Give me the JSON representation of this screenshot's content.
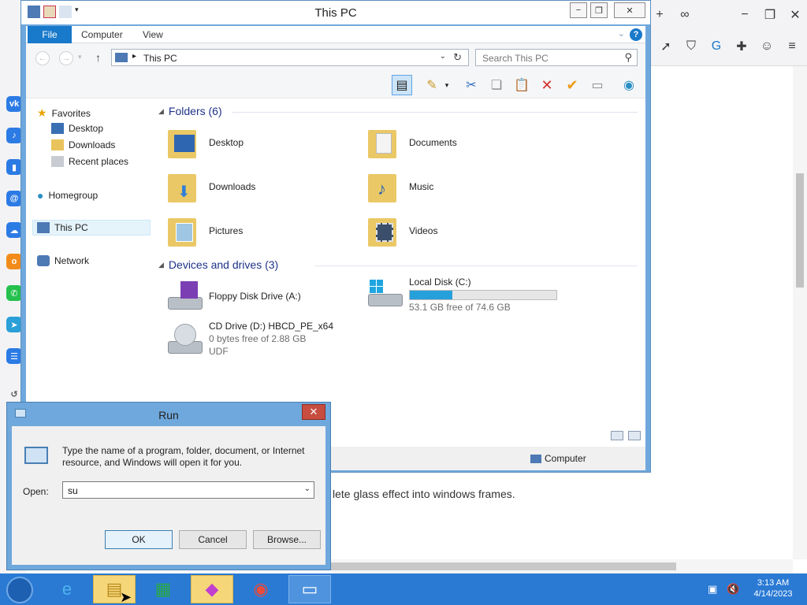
{
  "explorer": {
    "title": "This PC",
    "tabs": [
      "File",
      "Computer",
      "View"
    ],
    "address": "This PC",
    "search_placeholder": "Search This PC",
    "nav": {
      "favorites": "Favorites",
      "desktop": "Desktop",
      "downloads": "Downloads",
      "recent": "Recent places",
      "homegroup": "Homegroup",
      "thispc": "This PC",
      "network": "Network"
    },
    "folders_header": "Folders (6)",
    "folders": [
      "Desktop",
      "Documents",
      "Downloads",
      "Music",
      "Pictures",
      "Videos"
    ],
    "drives_header": "Devices and drives (3)",
    "drives": [
      {
        "name": "Floppy Disk Drive (A:)",
        "line2": "",
        "line3": ""
      },
      {
        "name": "Local Disk (C:)",
        "line2": "53.1 GB free of 74.6 GB",
        "line3": "",
        "used_fraction": 0.29
      },
      {
        "name": "CD Drive (D:) HBCD_PE_x64",
        "line2": "0 bytes free of 2.88 GB",
        "line3": "UDF"
      }
    ],
    "status_location": "Computer"
  },
  "run": {
    "title": "Run",
    "description": "Type the name of a program, folder, document, or Internet resource, and Windows will open it for you.",
    "open_label": "Open:",
    "open_value": "su",
    "ok": "OK",
    "cancel": "Cancel",
    "browse": "Browse..."
  },
  "browser": {
    "page_text": "lete glass effect into windows frames."
  },
  "taskbar": {
    "time": "3:13 AM",
    "date": "4/14/2023"
  },
  "colors": {
    "accent": "#1979ca",
    "window_frame": "#6fa8dc",
    "taskbar": "#2a7ad4",
    "disk_bar": "#26a0da"
  }
}
